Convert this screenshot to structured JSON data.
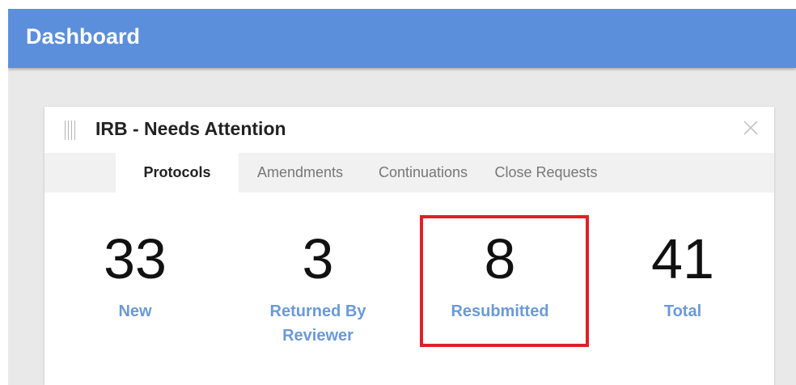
{
  "header": {
    "title": "Dashboard",
    "background_color": "#5b8fdb"
  },
  "widget": {
    "title": "IRB - Needs Attention",
    "drag_icon": "drag-handle-icon",
    "close_icon": "close-icon",
    "tabs": [
      {
        "label": "Protocols",
        "active": true
      },
      {
        "label": "Amendments",
        "active": false
      },
      {
        "label": "Continuations",
        "active": false
      },
      {
        "label": "Close Requests",
        "active": false
      }
    ],
    "stats": [
      {
        "value": "33",
        "label": "New"
      },
      {
        "value": "3",
        "label": "Returned By Reviewer"
      },
      {
        "value": "8",
        "label": "Resubmitted"
      },
      {
        "value": "41",
        "label": "Total"
      }
    ],
    "label_color": "#6a9ad8",
    "highlight": {
      "target": "Resubmitted",
      "color": "#e02028"
    }
  }
}
